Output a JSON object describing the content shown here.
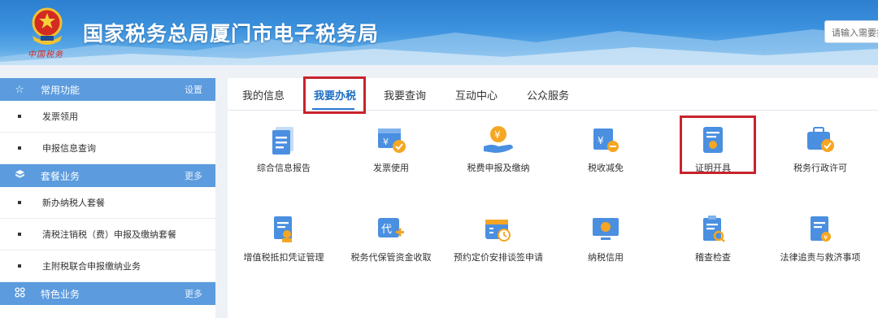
{
  "header": {
    "title": "国家税务总局厦门市电子税务局",
    "slogan": "中国税务",
    "search_placeholder": "请输入需要搜索"
  },
  "sidebar": {
    "sections": [
      {
        "title": "常用功能",
        "more": "设置",
        "icon": "star-icon",
        "items": [
          "发票领用",
          "申报信息查询"
        ]
      },
      {
        "title": "套餐业务",
        "more": "更多",
        "icon": "package-icon",
        "items": [
          "新办纳税人套餐",
          "清税注销税（费）申报及缴纳套餐",
          "主附税联合申报缴纳业务"
        ]
      },
      {
        "title": "特色业务",
        "more": "更多",
        "icon": "grid-icon",
        "items": []
      }
    ]
  },
  "tabs": [
    {
      "label": "我的信息",
      "active": false
    },
    {
      "label": "我要办税",
      "active": true
    },
    {
      "label": "我要查询",
      "active": false
    },
    {
      "label": "互动中心",
      "active": false
    },
    {
      "label": "公众服务",
      "active": false
    }
  ],
  "tiles_row1": [
    {
      "label": "综合信息报告",
      "icon": "document-report-icon"
    },
    {
      "label": "发票使用",
      "icon": "invoice-icon"
    },
    {
      "label": "税费申报及缴纳",
      "icon": "hand-coin-icon"
    },
    {
      "label": "税收减免",
      "icon": "tax-reduction-icon"
    },
    {
      "label": "证明开具",
      "icon": "certificate-icon"
    },
    {
      "label": "税务行政许可",
      "icon": "briefcase-check-icon"
    }
  ],
  "tiles_row2": [
    {
      "label": "增值税抵扣凭证管理",
      "icon": "stamp-document-icon"
    },
    {
      "label": "税务代保管资金收取",
      "icon": "proxy-fund-icon"
    },
    {
      "label": "预约定价安排谈签申请",
      "icon": "calendar-clock-icon"
    },
    {
      "label": "纳税信用",
      "icon": "credit-monitor-icon"
    },
    {
      "label": "稽查检查",
      "icon": "inspection-icon"
    },
    {
      "label": "法律追责与救济事项",
      "icon": "legal-coin-icon"
    }
  ],
  "colors": {
    "header_blue": "#3c92de",
    "sidebar_head": "#5b9bde",
    "active_tab": "#1f6fc4",
    "highlight_red": "#c8232d",
    "icon_blue": "#4a8fe0",
    "icon_orange": "#f5a623"
  }
}
